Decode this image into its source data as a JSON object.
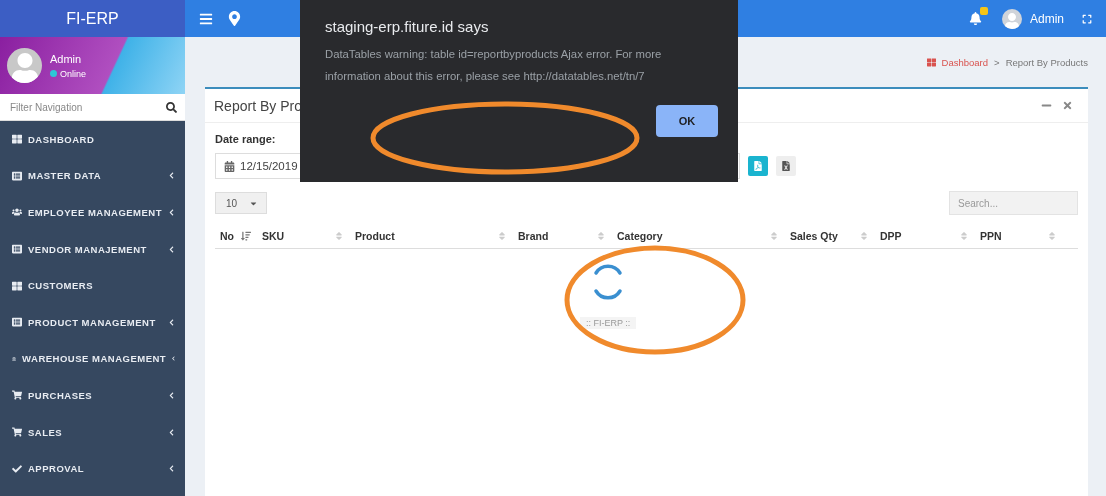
{
  "app": {
    "logo": "FI-ERP"
  },
  "topbar": {
    "user": "Admin"
  },
  "sidebar": {
    "user": {
      "name": "Admin",
      "status": "Online"
    },
    "filter": {
      "placeholder": "Filter Navigation"
    },
    "items": [
      {
        "label": "DASHBOARD",
        "kind": "grid",
        "has_submenu": false
      },
      {
        "label": "MASTER DATA",
        "kind": "list",
        "has_submenu": true
      },
      {
        "label": "EMPLOYEE MANAGEMENT",
        "kind": "users",
        "has_submenu": true
      },
      {
        "label": "VENDOR MANAJEMENT",
        "kind": "list",
        "has_submenu": true
      },
      {
        "label": "CUSTOMERS",
        "kind": "grid",
        "has_submenu": false
      },
      {
        "label": "PRODUCT MANAGEMENT",
        "kind": "list",
        "has_submenu": true
      },
      {
        "label": "WAREHOUSE MANAGEMENT",
        "kind": "bank",
        "has_submenu": true
      },
      {
        "label": "PURCHASES",
        "kind": "cart",
        "has_submenu": true
      },
      {
        "label": "SALES",
        "kind": "cart",
        "has_submenu": true
      },
      {
        "label": "APPROVAL",
        "kind": "check",
        "has_submenu": true
      }
    ]
  },
  "breadcrumb": {
    "items": [
      "Dashboard",
      "Report By Products"
    ],
    "separator": ">"
  },
  "card": {
    "title": "Report By Pro",
    "date_label": "Date range:",
    "date_value": "12/15/2019",
    "page_length": "10",
    "search": {
      "placeholder": "Search..."
    },
    "columns": [
      {
        "label": "No",
        "sorted": true
      },
      {
        "label": "SKU",
        "sorted": false
      },
      {
        "label": "Product",
        "sorted": false
      },
      {
        "label": "Brand",
        "sorted": false
      },
      {
        "label": "Category",
        "sorted": false
      },
      {
        "label": "Sales Qty",
        "sorted": false
      },
      {
        "label": "DPP",
        "sorted": false
      },
      {
        "label": "PPN",
        "sorted": false
      }
    ],
    "loader": ":: FI-ERP ::"
  },
  "dialog": {
    "title": "staging-erp.fiture.id says",
    "message": "DataTables warning: table id=reportbyproducts Ajax error. For more information about this error, please see http://datatables.net/tn/7",
    "button": "OK"
  }
}
